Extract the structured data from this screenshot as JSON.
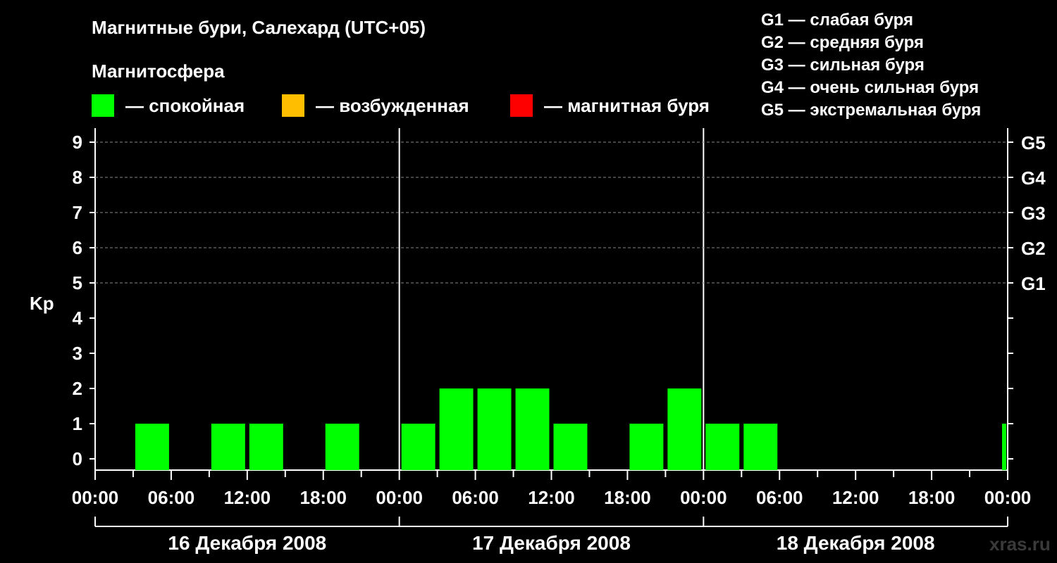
{
  "header": {
    "title": "Магнитные бури, Салехард (UTC+05)",
    "legend_heading": "Магнитосфера"
  },
  "legend": [
    {
      "label": "— спокойная",
      "color": "#00ff00"
    },
    {
      "label": "— возбужденная",
      "color": "#ffbf00"
    },
    {
      "label": "— магнитная буря",
      "color": "#ff0000"
    }
  ],
  "storm_levels": [
    "G1 — слабая буря",
    "G2 — средняя буря",
    "G3 — сильная буря",
    "G4 — очень сильная буря",
    "G5 — экстремальная буря"
  ],
  "watermark": "xras.ru",
  "chart_data": {
    "type": "bar",
    "ylabel": "Kp",
    "ylim": [
      0,
      9
    ],
    "y_ticks": [
      "0",
      "1",
      "2",
      "3",
      "4",
      "5",
      "6",
      "7",
      "8",
      "9"
    ],
    "right_axis_labels": [
      {
        "kp": 5,
        "label": "G1"
      },
      {
        "kp": 6,
        "label": "G2"
      },
      {
        "kp": 7,
        "label": "G3"
      },
      {
        "kp": 8,
        "label": "G4"
      },
      {
        "kp": 9,
        "label": "G5"
      }
    ],
    "x_tick_labels": [
      "00:00",
      "06:00",
      "12:00",
      "18:00",
      "00:00",
      "06:00",
      "12:00",
      "18:00",
      "00:00",
      "06:00",
      "12:00",
      "18:00",
      "00:00"
    ],
    "days": [
      "16 Декабря 2008",
      "17 Декабря 2008",
      "18 Декабря 2008"
    ],
    "interval_hours": 3,
    "intervals": [
      {
        "start": "2008-12-16 00:00",
        "kp": 0
      },
      {
        "start": "2008-12-16 03:00",
        "kp": 1
      },
      {
        "start": "2008-12-16 06:00",
        "kp": 0
      },
      {
        "start": "2008-12-16 09:00",
        "kp": 1
      },
      {
        "start": "2008-12-16 12:00",
        "kp": 1
      },
      {
        "start": "2008-12-16 15:00",
        "kp": 0
      },
      {
        "start": "2008-12-16 18:00",
        "kp": 1
      },
      {
        "start": "2008-12-16 21:00",
        "kp": 0
      },
      {
        "start": "2008-12-17 00:00",
        "kp": 1
      },
      {
        "start": "2008-12-17 03:00",
        "kp": 2
      },
      {
        "start": "2008-12-17 06:00",
        "kp": 2
      },
      {
        "start": "2008-12-17 09:00",
        "kp": 2
      },
      {
        "start": "2008-12-17 12:00",
        "kp": 1
      },
      {
        "start": "2008-12-17 15:00",
        "kp": 0
      },
      {
        "start": "2008-12-17 18:00",
        "kp": 1
      },
      {
        "start": "2008-12-17 21:00",
        "kp": 2
      },
      {
        "start": "2008-12-18 00:00",
        "kp": 1
      },
      {
        "start": "2008-12-18 03:00",
        "kp": 1
      }
    ],
    "partial_last_bar": {
      "start": "2008-12-18 23:40",
      "end": "2008-12-19 00:00",
      "kp": 1
    },
    "bar_color": "#00ff00",
    "grid": "dashed horizontal at Kp 5–9"
  }
}
